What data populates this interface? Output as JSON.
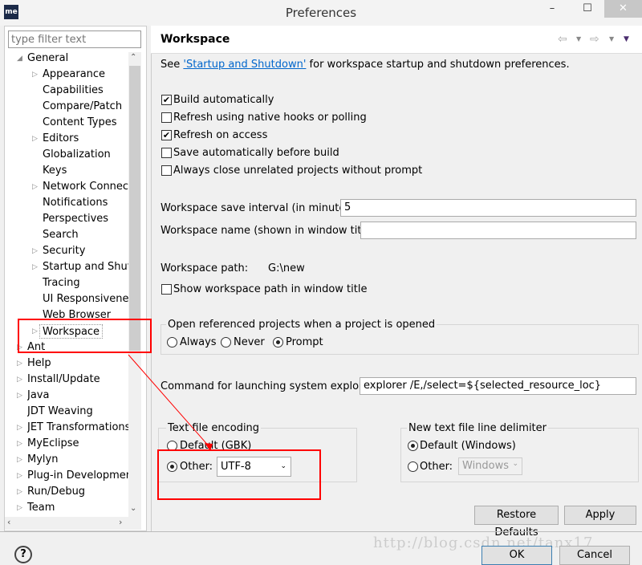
{
  "window": {
    "title": "Preferences",
    "app_icon": "me"
  },
  "filter": {
    "placeholder": "type filter text"
  },
  "tree": [
    {
      "label": "General",
      "level": 0,
      "arrow": "expanded"
    },
    {
      "label": "Appearance",
      "level": 1,
      "arrow": "collapsed"
    },
    {
      "label": "Capabilities",
      "level": 1
    },
    {
      "label": "Compare/Patch",
      "level": 1
    },
    {
      "label": "Content Types",
      "level": 1
    },
    {
      "label": "Editors",
      "level": 1,
      "arrow": "collapsed"
    },
    {
      "label": "Globalization",
      "level": 1
    },
    {
      "label": "Keys",
      "level": 1
    },
    {
      "label": "Network Connecti",
      "level": 1,
      "arrow": "collapsed"
    },
    {
      "label": "Notifications",
      "level": 1
    },
    {
      "label": "Perspectives",
      "level": 1
    },
    {
      "label": "Search",
      "level": 1
    },
    {
      "label": "Security",
      "level": 1,
      "arrow": "collapsed"
    },
    {
      "label": "Startup and Shutd",
      "level": 1,
      "arrow": "collapsed"
    },
    {
      "label": "Tracing",
      "level": 1
    },
    {
      "label": "UI Responsiveness",
      "level": 1
    },
    {
      "label": "Web Browser",
      "level": 1
    },
    {
      "label": "Workspace",
      "level": 1,
      "arrow": "collapsed",
      "selected": true
    },
    {
      "label": "Ant",
      "level": 0,
      "arrow": "collapsed"
    },
    {
      "label": "Help",
      "level": 0,
      "arrow": "collapsed"
    },
    {
      "label": "Install/Update",
      "level": 0,
      "arrow": "collapsed"
    },
    {
      "label": "Java",
      "level": 0,
      "arrow": "collapsed"
    },
    {
      "label": "JDT Weaving",
      "level": 0
    },
    {
      "label": "JET Transformations",
      "level": 0,
      "arrow": "collapsed"
    },
    {
      "label": "MyEclipse",
      "level": 0,
      "arrow": "collapsed"
    },
    {
      "label": "Mylyn",
      "level": 0,
      "arrow": "collapsed"
    },
    {
      "label": "Plug-in Development",
      "level": 0,
      "arrow": "collapsed"
    },
    {
      "label": "Run/Debug",
      "level": 0,
      "arrow": "collapsed"
    },
    {
      "label": "Team",
      "level": 0,
      "arrow": "collapsed"
    }
  ],
  "page": {
    "title": "Workspace",
    "intro_pre": "See ",
    "intro_link": "'Startup and Shutdown'",
    "intro_post": " for workspace startup and shutdown preferences.",
    "checks": [
      {
        "label": "Build automatically",
        "checked": true
      },
      {
        "label": "Refresh using native hooks or polling",
        "checked": false
      },
      {
        "label": "Refresh on access",
        "checked": true
      },
      {
        "label": "Save automatically before build",
        "checked": false
      },
      {
        "label": "Always close unrelated projects without prompt",
        "checked": false
      }
    ],
    "save_interval_label": "Workspace save interval (in minutes):",
    "save_interval_value": "5",
    "name_label": "Workspace name (shown in window title):",
    "name_value": "",
    "path_label": "Workspace path:",
    "path_value": "G:\\new",
    "show_path_label": "Show workspace path in window title",
    "open_ref": {
      "label": "Open referenced projects when a project is opened",
      "options": [
        "Always",
        "Never",
        "Prompt"
      ],
      "selected": "Prompt"
    },
    "explorer_label": "Command for launching system explorer:",
    "explorer_value": "explorer /E,/select=${selected_resource_loc}",
    "encoding": {
      "label": "Text file encoding",
      "default": "Default (GBK)",
      "other": "Other:",
      "value": "UTF-8",
      "selected": "other"
    },
    "delimiter": {
      "label": "New text file line delimiter",
      "default": "Default (Windows)",
      "other": "Other:",
      "value": "Windows",
      "selected": "default"
    },
    "restore": "Restore Defaults",
    "apply": "Apply"
  },
  "footer": {
    "ok": "OK",
    "cancel": "Cancel",
    "watermark": "http://blog.csdn.net/tanx17"
  },
  "colors": {
    "annotation": "#ff0000",
    "link": "#0066cc"
  }
}
